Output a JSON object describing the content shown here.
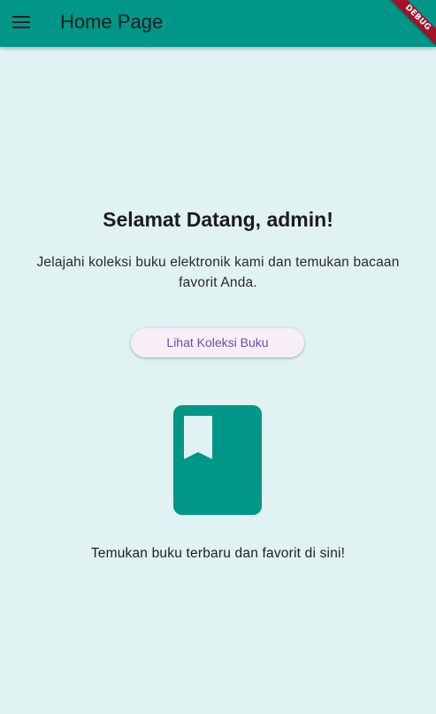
{
  "app_bar": {
    "title": "Home Page",
    "menu_icon": "hamburger-menu-icon",
    "background_color": "#009688"
  },
  "debug_banner": {
    "label": "DEBUG",
    "color": "#a5122a"
  },
  "main": {
    "welcome_title": "Selamat Datang, admin!",
    "description": "Jelajahi koleksi buku elektronik kami dan temukan bacaan favorit Anda.",
    "collection_button_label": "Lihat Koleksi Buku",
    "book_icon": "bookmark-book-icon",
    "tagline": "Temukan buku terbaru dan favorit di sini!"
  },
  "colors": {
    "page_background": "#e0f2f1",
    "accent": "#009688",
    "button_text": "#6750a4"
  }
}
